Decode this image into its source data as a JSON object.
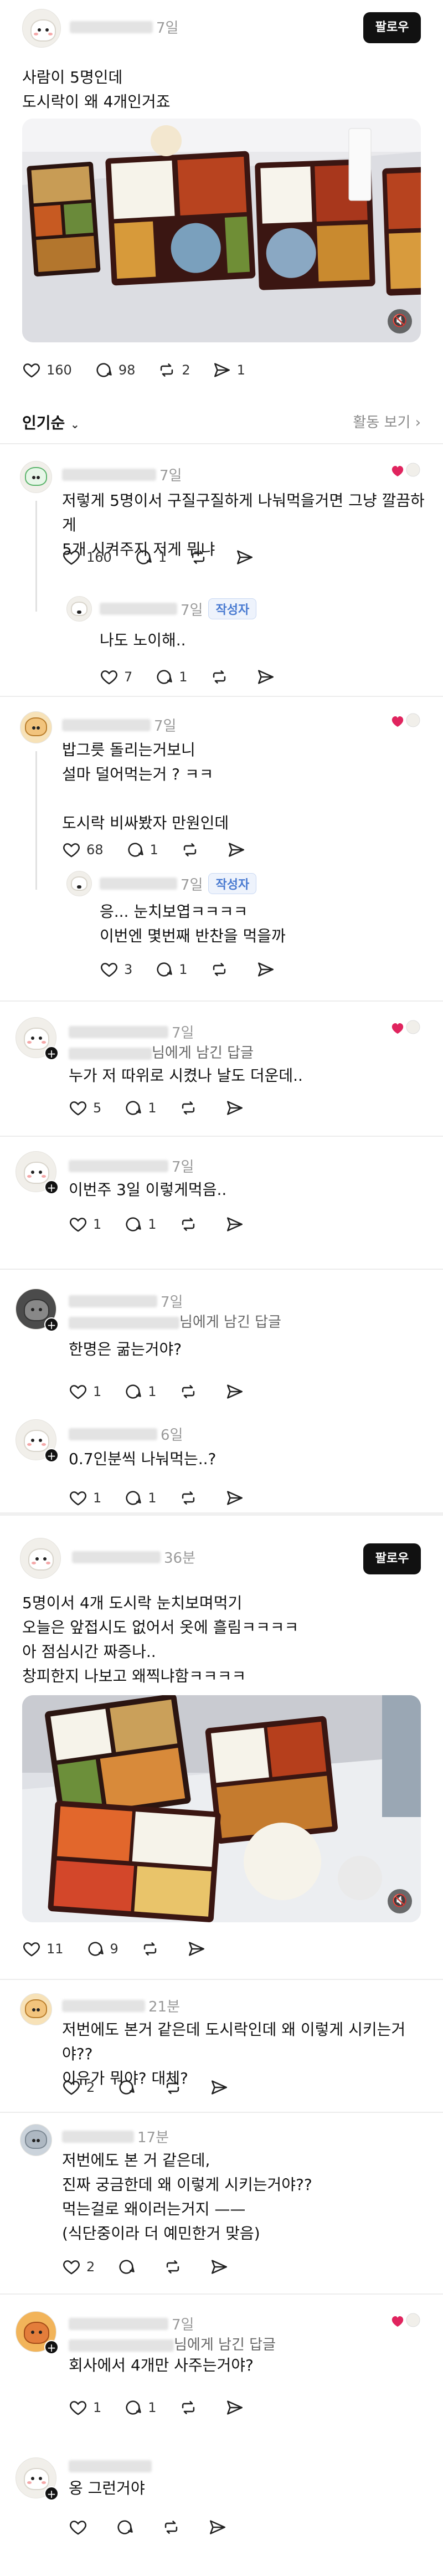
{
  "post1": {
    "username": "",
    "time": "7일",
    "follow_label": "팔로우",
    "text": "사람이 5명인데\n도시락이 왜 4개인거죠",
    "counts": {
      "like": "160",
      "comment": "98",
      "repost": "2",
      "share": "1"
    }
  },
  "sort": {
    "label": "인기순",
    "activity_label": "활동 보기"
  },
  "comments": [
    {
      "time": "7일",
      "text": "저렇게 5명이서 구질구질하게 나눠먹을거면 그냥 깔끔하게\n5개 시켜주지 저게 뭐냐",
      "like": "160",
      "comment": "1"
    },
    {
      "time": "7일",
      "author_badge": "작성자",
      "text": "나도 노이해..",
      "like": "7",
      "comment": "1"
    },
    {
      "time": "7일",
      "text": "밥그릇 돌리는거보니\n설마 덜어먹는거 ? ㅋㅋ\n\n도시락 비싸봤자 만원인데",
      "like": "68",
      "comment": "1"
    },
    {
      "time": "7일",
      "author_badge": "작성자",
      "text": "응... 눈치보엽ㅋㅋㅋㅋ\n이번엔 몇번째 반찬을 먹을까",
      "like": "3",
      "comment": "1"
    },
    {
      "time": "7일",
      "to_label": "님에게 남긴 답글",
      "text": "누가 저 따위로 시켰나 날도 더운데..",
      "like": "5",
      "comment": "1"
    },
    {
      "time": "7일",
      "text": "이번주 3일 이렇게먹음..",
      "like": "1",
      "comment": "1"
    },
    {
      "time": "7일",
      "to_label": "님에게 남긴 답글",
      "text": "한명은 굶는거야?",
      "like": "1",
      "comment": "1"
    },
    {
      "time": "6일",
      "text": "0.7인분씩 나눠먹는..?",
      "like": "1",
      "comment": "1"
    }
  ],
  "post2": {
    "time": "36분",
    "follow_label": "팔로우",
    "text": "5명이서 4개 도시락 눈치보며먹기\n오늘은 앞접시도 없어서 옷에 흘림ㅋㅋㅋㅋ\n아 점심시간 짜증나..\n창피한지 나보고 왜찍냐함ㅋㅋㅋㅋ",
    "counts": {
      "like": "11",
      "comment": "9"
    }
  },
  "comments2": [
    {
      "time": "21분",
      "text": "저번에도 본거 같은데 도시락인데 왜 이렇게 시키는거야??\n이유가 뭐야? 대체?",
      "like": "2"
    },
    {
      "time": "17분",
      "text": "저번에도 본 거 같은데,\n진짜 궁금한데 왜 이렇게 시키는거야??\n먹는걸로 왜이러는거지 ——\n(식단중이라 더 예민한거 맞음)",
      "like": "2"
    },
    {
      "time": "7일",
      "to_label": "님에게 남긴 답글",
      "text": "회사에서 4개만 사주는거야?",
      "like": "1",
      "comment": "1"
    },
    {
      "time": "",
      "text": "옹 그런거야"
    }
  ],
  "icons": [
    "heart-icon",
    "comment-icon",
    "repost-icon",
    "share-icon",
    "mute-icon",
    "chevron-down-icon",
    "plus-icon"
  ],
  "colors": {
    "accent_red": "#e0245e",
    "badge_blue": "#4a7bd1"
  }
}
